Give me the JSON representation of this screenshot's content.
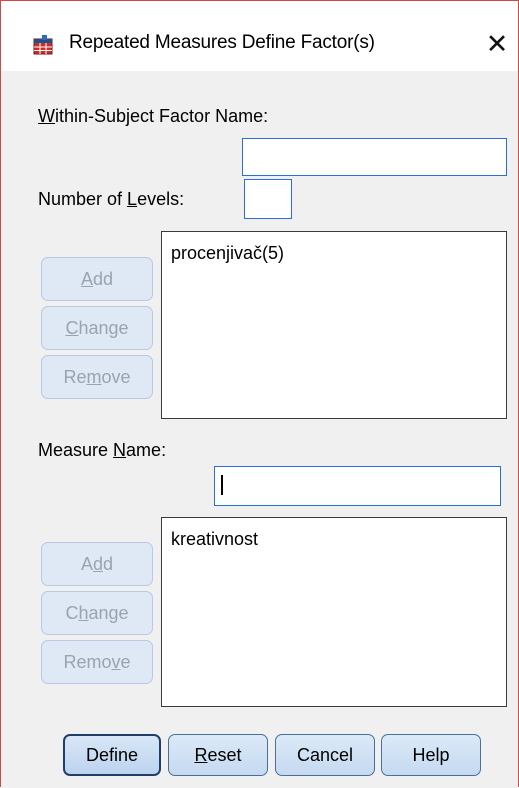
{
  "window": {
    "title": "Repeated Measures Define Factor(s)",
    "close_glyph": "✕"
  },
  "factor": {
    "name_label": "Within-Subject Factor Name:",
    "name_value": "",
    "levels_label": "Number of Levels:",
    "levels_value": "",
    "list_items": [
      "procenjivač(5)"
    ],
    "add_label": "Add",
    "change_label": "Change",
    "remove_label": "Remove"
  },
  "measure": {
    "name_label": "Measure Name:",
    "name_value": "",
    "list_items": [
      "kreativnost"
    ],
    "add_label": "Add",
    "change_label": "Change",
    "remove_label": "Remove"
  },
  "footer": {
    "define_label": "Define",
    "reset_label": "Reset",
    "cancel_label": "Cancel",
    "help_label": "Help"
  },
  "colors": {
    "dialog_bg": "#f0f0f0",
    "title_bg": "#ffffff",
    "window_border": "#d04848",
    "focus_border": "#2b6fd6",
    "disabled_text": "#9aa3ae"
  },
  "icons": {
    "app": "spss-grid-icon",
    "close": "close-icon"
  }
}
